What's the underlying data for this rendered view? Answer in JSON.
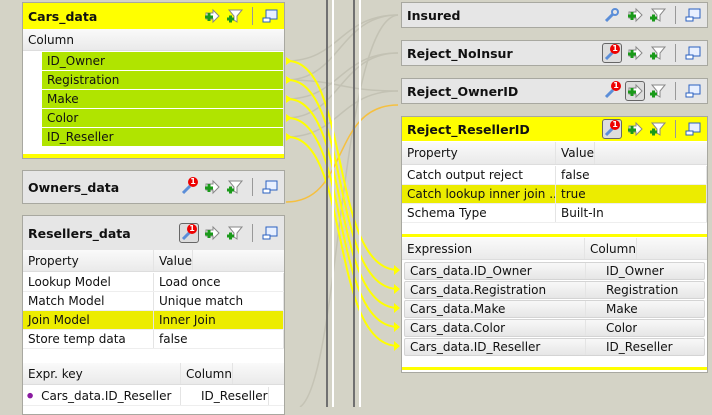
{
  "inputs": {
    "cars": {
      "title": "Cars_data",
      "column_header": "Column",
      "columns": [
        "ID_Owner",
        "Registration",
        "Make",
        "Color",
        "ID_Reseller"
      ]
    },
    "owners": {
      "title": "Owners_data",
      "badge": "1"
    },
    "resellers": {
      "title": "Resellers_data",
      "badge": "1",
      "prop_header": "Property",
      "value_header": "Value",
      "properties": [
        {
          "p": "Lookup Model",
          "v": "Load once"
        },
        {
          "p": "Match Model",
          "v": "Unique match"
        },
        {
          "p": "Join Model",
          "v": "Inner Join"
        },
        {
          "p": "Store temp data",
          "v": "false"
        }
      ],
      "key_header": "Expr. key",
      "col_header": "Column",
      "keys": [
        {
          "expr": "Cars_data.ID_Reseller",
          "col": "ID_Reseller"
        }
      ]
    }
  },
  "outputs": {
    "insured": {
      "title": "Insured"
    },
    "noinsur": {
      "title": "Reject_NoInsur",
      "badge": "1"
    },
    "ownerid": {
      "title": "Reject_OwnerID",
      "badge": "1"
    },
    "resellerid": {
      "title": "Reject_ResellerID",
      "badge": "1",
      "prop_header": "Property",
      "value_header": "Value",
      "properties": [
        {
          "p": "Catch output reject",
          "v": "false"
        },
        {
          "p": "Catch lookup inner join ...",
          "v": "true"
        },
        {
          "p": "Schema Type",
          "v": "Built-In"
        }
      ],
      "expr_header": "Expression",
      "col_header": "Column",
      "rows": [
        {
          "e": "Cars_data.ID_Owner",
          "c": "ID_Owner"
        },
        {
          "e": "Cars_data.Registration",
          "c": "Registration"
        },
        {
          "e": "Cars_data.Make",
          "c": "Make"
        },
        {
          "e": "Cars_data.Color",
          "c": "Color"
        },
        {
          "e": "Cars_data.ID_Reseller",
          "c": "ID_Reseller"
        }
      ]
    }
  },
  "colors": {
    "selected": "#ffff00",
    "mapped": "#b0e400",
    "highlight": "#ecec00",
    "link": "#ffff00",
    "lookup_link": "#f5c040"
  }
}
